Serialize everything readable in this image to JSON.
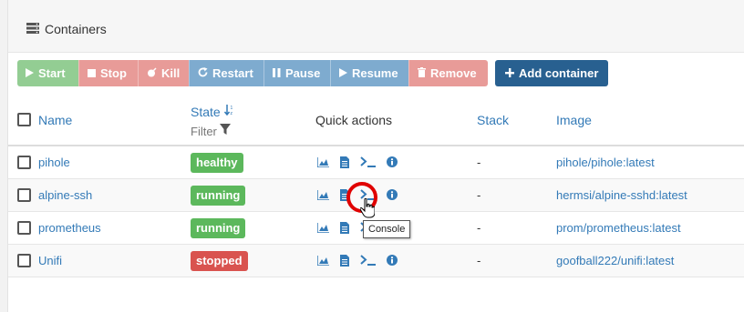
{
  "panel": {
    "title": "Containers"
  },
  "toolbar": {
    "start": "Start",
    "stop": "Stop",
    "kill": "Kill",
    "restart": "Restart",
    "pause": "Pause",
    "resume": "Resume",
    "remove": "Remove",
    "add": "Add container"
  },
  "table": {
    "headers": {
      "name": "Name",
      "state": "State",
      "filter": "Filter",
      "quick_actions": "Quick actions",
      "stack": "Stack",
      "image": "Image"
    },
    "rows": [
      {
        "name": "pihole",
        "state": "healthy",
        "stack": "-",
        "image": "pihole/pihole:latest"
      },
      {
        "name": "alpine-ssh",
        "state": "running",
        "stack": "-",
        "image": "hermsi/alpine-sshd:latest"
      },
      {
        "name": "prometheus",
        "state": "running",
        "stack": "-",
        "image": "prom/prometheus:latest"
      },
      {
        "name": "Unifi",
        "state": "stopped",
        "stack": "-",
        "image": "goofball222/unifi:latest"
      }
    ]
  },
  "tooltip": {
    "text": "Console"
  },
  "colors": {
    "link": "#337ab7",
    "healthy": "#5cb85c",
    "running": "#5cb85c",
    "stopped": "#d9534f",
    "add_button": "#286090",
    "highlight_circle": "#e00000"
  },
  "icons": {
    "panel": "server-icon",
    "quick_actions": [
      "stats-icon",
      "logs-icon",
      "console-icon",
      "inspect-icon"
    ]
  }
}
